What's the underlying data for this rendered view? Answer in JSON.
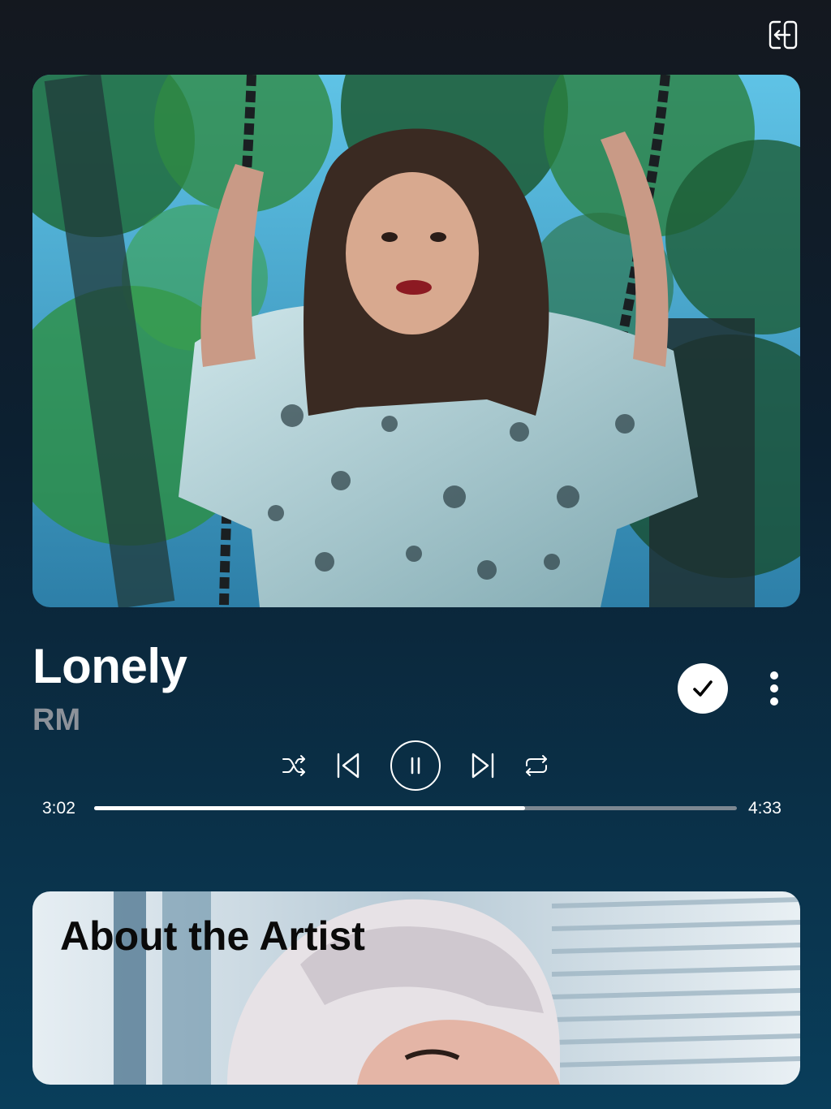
{
  "header": {
    "exit_icon": "exit-fullscreen-icon"
  },
  "now_playing": {
    "title": "Lonely",
    "artist": "RM",
    "added_icon": "checkmark-icon",
    "more_icon": "more-vertical-icon"
  },
  "controls": {
    "shuffle_icon": "shuffle-icon",
    "previous_icon": "skip-previous-icon",
    "play_pause_icon": "pause-icon",
    "next_icon": "skip-next-icon",
    "repeat_icon": "repeat-icon"
  },
  "progress": {
    "elapsed": "3:02",
    "total": "4:33",
    "fraction": 0.67
  },
  "artist_card": {
    "title": "About the Artist"
  },
  "colors": {
    "accent": "#ffffff",
    "muted_text": "#8c929a",
    "track": "#7c8791"
  }
}
